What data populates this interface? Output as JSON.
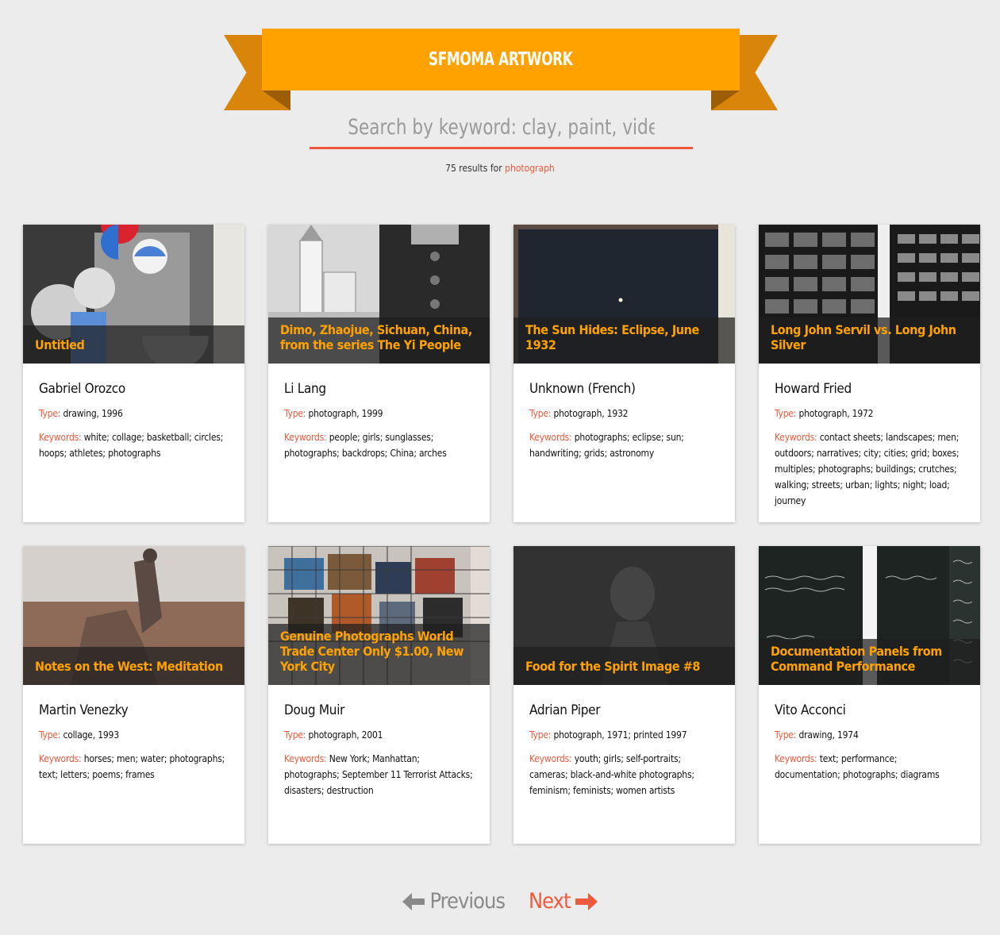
{
  "header": {
    "title": "SFMOMA ARTWORK"
  },
  "search": {
    "placeholder": "Search by keyword: clay, paint, video..."
  },
  "results": {
    "prefix": "75 results for",
    "term": "photograph"
  },
  "labels": {
    "type": "Type:",
    "keywords": "Keywords:"
  },
  "cards": [
    {
      "title": "Untitled",
      "artist": "Gabriel Orozco",
      "type": "drawing, 1996",
      "keywords": "white; collage; basketball; circles; hoops; athletes; photographs"
    },
    {
      "title": "Dimo, Zhaojue, Sichuan, China, from the series The Yi People",
      "artist": "Li Lang",
      "type": "photograph, 1999",
      "keywords": "people; girls; sunglasses; photographs; backdrops; China; arches"
    },
    {
      "title": "The Sun Hides: Eclipse, June 1932",
      "artist": "Unknown (French)",
      "type": "photograph, 1932",
      "keywords": "photographs; eclipse; sun; handwriting; grids; astronomy"
    },
    {
      "title": "Long John Servil vs. Long John Silver",
      "artist": "Howard Fried",
      "type": "photograph, 1972",
      "keywords": "contact sheets; landscapes; men; outdoors; narratives; city; cities; grid; boxes; multiples; photographs; buildings; crutches; walking; streets; urban; lights; night; load; journey"
    },
    {
      "title": "Notes on the West: Meditation",
      "artist": "Martin Venezky",
      "type": "collage, 1993",
      "keywords": "horses; men; water; photographs; text; letters; poems; frames"
    },
    {
      "title": "Genuine Photographs World Trade Center Only $1.00, New York City",
      "artist": "Doug Muir",
      "type": "photograph, 2001",
      "keywords": "New York; Manhattan; photographs; September 11 Terrorist Attacks; disasters; destruction"
    },
    {
      "title": "Food for the Spirit Image #8",
      "artist": "Adrian Piper",
      "type": "photograph, 1971; printed 1997",
      "keywords": "youth; girls; self-portraits; cameras; black-and-white photographs; feminism; feminists; women artists"
    },
    {
      "title": "Documentation Panels from Command Performance",
      "artist": "Vito Acconci",
      "type": "drawing, 1974",
      "keywords": "text; performance; documentation; photographs; diagrams"
    }
  ],
  "pager": {
    "previous": "Previous",
    "next": "Next"
  },
  "colors": {
    "accent": "#ffa200",
    "accent_dark": "#d9850a",
    "link": "#f05a3c",
    "background": "#ececec"
  }
}
